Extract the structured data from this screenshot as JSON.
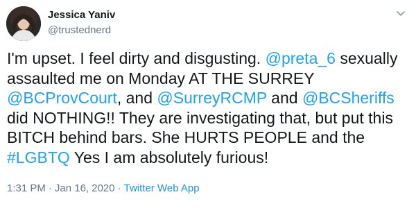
{
  "author": {
    "display_name": "Jessica Yaniv",
    "handle": "@trustednerd"
  },
  "tweet": {
    "segments": [
      {
        "type": "text",
        "text": "I'm upset. I feel dirty and disgusting. "
      },
      {
        "type": "mention",
        "text": "@preta_6"
      },
      {
        "type": "text",
        "text": " sexually assaulted me on Monday AT THE SURREY "
      },
      {
        "type": "mention",
        "text": "@BCProvCourt"
      },
      {
        "type": "text",
        "text": ", and "
      },
      {
        "type": "mention",
        "text": "@SurreyRCMP"
      },
      {
        "type": "text",
        "text": " and "
      },
      {
        "type": "mention",
        "text": "@BCSheriffs"
      },
      {
        "type": "text",
        "text": " did NOTHING!! They are investigating that, but put this BITCH behind bars. She HURTS PEOPLE and the "
      },
      {
        "type": "hashtag",
        "text": "#LGBTQ"
      },
      {
        "type": "text",
        "text": " Yes I am absolutely furious!"
      }
    ]
  },
  "meta": {
    "time": "1:31 PM",
    "separator_1": "·",
    "date": "Jan 16, 2020",
    "separator_2": "·",
    "source": "Twitter Web App"
  },
  "icons": {
    "menu": "chevron-down-icon"
  },
  "colors": {
    "link": "#1da1f2",
    "source_link": "#1b95e0",
    "secondary_text": "#657786",
    "primary_text": "#14171a"
  }
}
